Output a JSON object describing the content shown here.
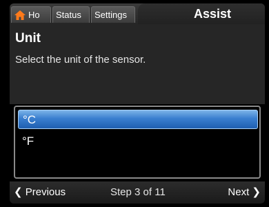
{
  "tabs": {
    "home_label": "Ho",
    "status_label": "Status",
    "settings_label": "Settings",
    "active_label": "Assist"
  },
  "page": {
    "title": "Unit",
    "description": "Select the unit of the sensor."
  },
  "options": [
    {
      "label": "°C",
      "selected": true
    },
    {
      "label": "°F",
      "selected": false
    }
  ],
  "footer": {
    "previous_label": "Previous",
    "step_text": "Step 3 of 11",
    "next_label": "Next"
  },
  "icons": {
    "home": "home-icon",
    "previous": "chevron-left-icon",
    "next": "chevron-right-icon"
  },
  "colors": {
    "selection": "#2f72c6",
    "background": "#262626"
  }
}
